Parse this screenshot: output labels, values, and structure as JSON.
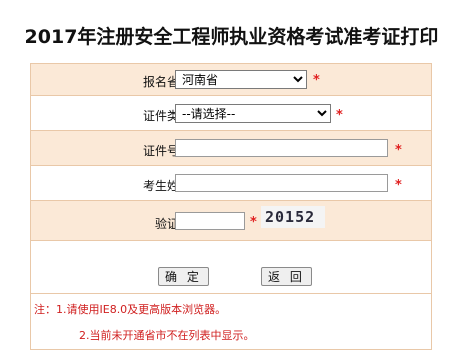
{
  "page": {
    "title": "2017年注册安全工程师执业资格考试准考证打印"
  },
  "form": {
    "province_label": "报名省市:",
    "province_value": "河南省",
    "id_type_label": "证件类型:",
    "id_type_value": "--请选择--",
    "id_number_label": "证件号码:",
    "id_number_value": "",
    "name_label": "考生姓名:",
    "name_value": "",
    "captcha_label": "验证码:",
    "captcha_value": "",
    "captcha_image_text": "20152",
    "required_mark": "*"
  },
  "buttons": {
    "confirm_label": "确 定",
    "back_label": "返 回"
  },
  "notes": {
    "line1": "注：1.请使用IE8.0及更高版本浏览器。",
    "line2": "2.当前未开通省市不在列表中显示。"
  },
  "colors": {
    "row_shade": "#fbe9d7",
    "border": "#e9c8a8",
    "required": "#e02020",
    "note_text": "#d02020"
  }
}
